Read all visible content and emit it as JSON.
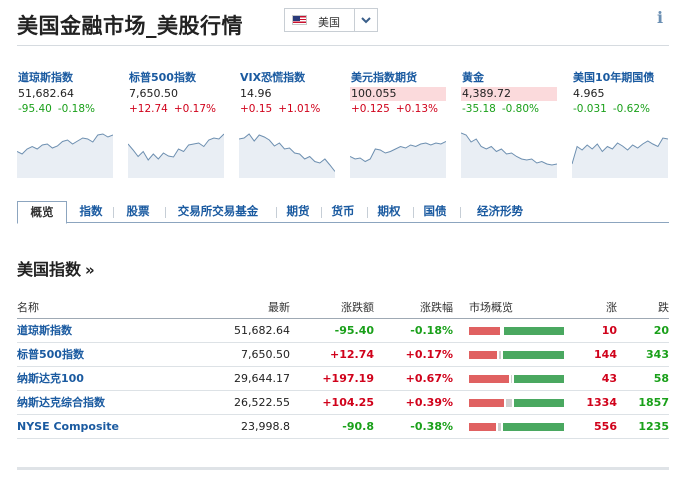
{
  "header": {
    "title": "美国金融市场_美股行情",
    "region": "美国",
    "icons": {
      "flag": "us-flag-icon",
      "dropdown": "chevron-down-icon",
      "info": "info-icon"
    },
    "info_glyph": "i"
  },
  "colors": {
    "up": "#d0021b",
    "down": "#1aa01a",
    "link": "#1a5aa0",
    "bar_up": "#e06161",
    "bar_down": "#4aa860",
    "bar_flat": "#cfcfcf"
  },
  "tickers": [
    {
      "name": "道琼斯指数",
      "value": "51,682.64",
      "change": "-95.40",
      "percent": "-0.18%",
      "direction": "down",
      "highlight": false,
      "spark": [
        0.45,
        0.4,
        0.5,
        0.55,
        0.5,
        0.58,
        0.6,
        0.52,
        0.56,
        0.65,
        0.68,
        0.6,
        0.66,
        0.72,
        0.7,
        0.64,
        0.78,
        0.8,
        0.74,
        0.78
      ]
    },
    {
      "name": "标普500指数",
      "value": "7,650.50",
      "change": "+12.74",
      "percent": "+0.17%",
      "direction": "up",
      "highlight": false,
      "spark": [
        0.6,
        0.48,
        0.35,
        0.45,
        0.28,
        0.4,
        0.3,
        0.42,
        0.36,
        0.34,
        0.5,
        0.45,
        0.58,
        0.6,
        0.62,
        0.55,
        0.68,
        0.72,
        0.7,
        0.8
      ]
    },
    {
      "name": "VIX恐慌指数",
      "value": "14.96",
      "change": "+0.15",
      "percent": "+1.01%",
      "direction": "up",
      "highlight": false,
      "spark": [
        0.7,
        0.72,
        0.8,
        0.66,
        0.78,
        0.74,
        0.68,
        0.56,
        0.62,
        0.5,
        0.52,
        0.42,
        0.4,
        0.3,
        0.35,
        0.25,
        0.22,
        0.3,
        0.18,
        0.05
      ]
    },
    {
      "name": "美元指数期货",
      "value": "100.055",
      "change": "+0.125",
      "percent": "+0.13%",
      "direction": "up",
      "highlight": true,
      "spark": [
        0.35,
        0.3,
        0.32,
        0.25,
        0.3,
        0.5,
        0.48,
        0.42,
        0.45,
        0.5,
        0.55,
        0.52,
        0.58,
        0.55,
        0.6,
        0.62,
        0.58,
        0.62,
        0.6,
        0.65
      ]
    },
    {
      "name": "黄金",
      "value": "4,389.72",
      "change": "-35.18",
      "percent": "-0.80%",
      "direction": "down",
      "highlight": true,
      "spark": [
        0.82,
        0.78,
        0.64,
        0.7,
        0.55,
        0.5,
        0.55,
        0.45,
        0.5,
        0.4,
        0.42,
        0.35,
        0.3,
        0.28,
        0.3,
        0.22,
        0.25,
        0.2,
        0.18,
        0.2
      ]
    },
    {
      "name": "美国10年期国债",
      "value": "4.965",
      "change": "-0.031",
      "percent": "-0.62%",
      "direction": "down",
      "highlight": false,
      "spark": [
        0.2,
        0.55,
        0.48,
        0.58,
        0.5,
        0.6,
        0.45,
        0.55,
        0.5,
        0.62,
        0.56,
        0.48,
        0.58,
        0.52,
        0.6,
        0.66,
        0.6,
        0.55,
        0.72,
        0.7
      ]
    }
  ],
  "tabs": [
    {
      "label": "概览",
      "active": true
    },
    {
      "label": "指数",
      "active": false
    },
    {
      "label": "股票",
      "active": false
    },
    {
      "label": "交易所交易基金",
      "active": false
    },
    {
      "label": "期货",
      "active": false
    },
    {
      "label": "货币",
      "active": false
    },
    {
      "label": "期权",
      "active": false
    },
    {
      "label": "国债",
      "active": false
    },
    {
      "label": "经济形势",
      "active": false
    }
  ],
  "section": {
    "title": "美国指数",
    "arrow": "»"
  },
  "table": {
    "columns": {
      "name": "名称",
      "last": "最新",
      "change": "涨跌额",
      "percent": "涨跌幅",
      "map": "市场概览",
      "advancers": "涨",
      "decliners": "跌"
    },
    "rows": [
      {
        "name": "道琼斯指数",
        "last": "51,682.64",
        "change": "-95.40",
        "percent": "-0.18%",
        "direction": "down",
        "advancers": "10",
        "decliners": "20",
        "breadth": {
          "up": 0.33,
          "flat": 0.0,
          "down": 0.67
        }
      },
      {
        "name": "标普500指数",
        "last": "7,650.50",
        "change": "+12.74",
        "percent": "+0.17%",
        "direction": "up",
        "advancers": "144",
        "decliners": "343",
        "breadth": {
          "up": 0.29,
          "flat": 0.02,
          "down": 0.69
        }
      },
      {
        "name": "纳斯达克100",
        "last": "29,644.17",
        "change": "+197.19",
        "percent": "+0.67%",
        "direction": "up",
        "advancers": "43",
        "decliners": "58",
        "breadth": {
          "up": 0.42,
          "flat": 0.01,
          "down": 0.57
        }
      },
      {
        "name": "纳斯达克综合指数",
        "last": "26,522.55",
        "change": "+104.25",
        "percent": "+0.39%",
        "direction": "up",
        "advancers": "1334",
        "decliners": "1857",
        "breadth": {
          "up": 0.37,
          "flat": 0.06,
          "down": 0.57
        }
      },
      {
        "name": "NYSE Composite",
        "last": "23,998.8",
        "change": "-90.8",
        "percent": "-0.38%",
        "direction": "down",
        "advancers": "556",
        "decliners": "1235",
        "breadth": {
          "up": 0.28,
          "flat": 0.03,
          "down": 0.69
        }
      }
    ]
  }
}
